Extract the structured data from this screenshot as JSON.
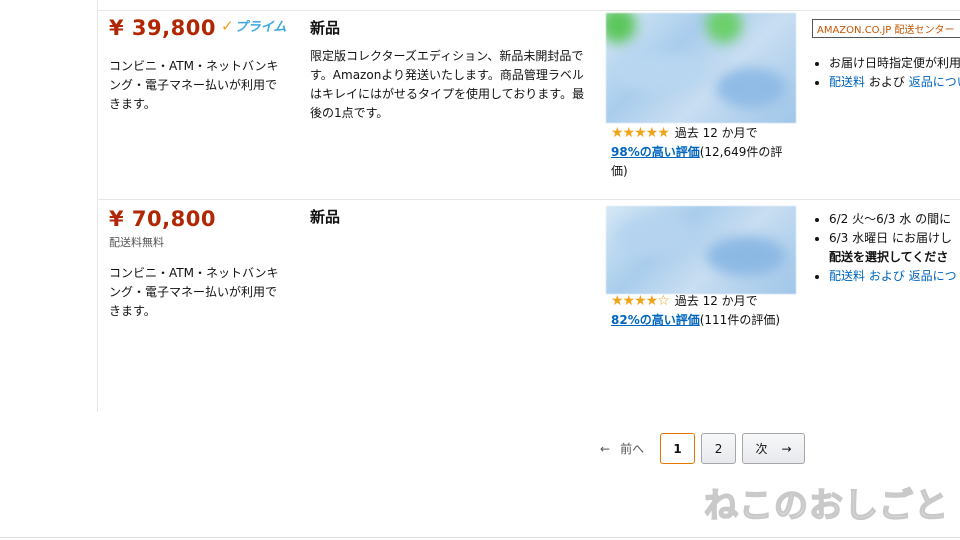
{
  "offers": [
    {
      "price": "¥ 39,800",
      "prime_label": "プライム",
      "shipping_note": "",
      "payment": "コンビニ・ATM・ネットバンキング・電子マネー払いが利用できます。",
      "condition": "新品",
      "description": "限定版コレクターズエディション、新品未開封品です。Amazonより発送いたします。商品管理ラベルはキレイにはがせるタイプを使用しております。最後の1点です。",
      "stars": "★★★★★",
      "period": "過去 12 か月で",
      "rating_link": "98%の高い評価",
      "rating_count": "(12,649件の評価)",
      "badge": "AMAZON.CO.JP 配送センター",
      "delivery": [
        {
          "text": "お届け日時指定便が利用",
          "links": []
        },
        {
          "text": "",
          "links": [
            "配送料",
            "および",
            "返品について"
          ]
        }
      ]
    },
    {
      "price": "¥ 70,800",
      "prime_label": "",
      "shipping_note": "配送料無料",
      "payment": "コンビニ・ATM・ネットバンキング・電子マネー払いが利用できます。",
      "condition": "新品",
      "description": "",
      "stars": "★★★★☆",
      "period": "過去 12 か月で",
      "rating_link": "82%の高い評価",
      "rating_count": "(111件の評価)",
      "delivery_lines": [
        "6/2 火～6/3 水 の間に",
        "6/3 水曜日 にお届けし",
        "配送を選択してくださ",
        "配送料 および 返品につ"
      ]
    }
  ],
  "pagination": {
    "prev": "前へ",
    "prev_arrow": "←",
    "pages": [
      "1",
      "2"
    ],
    "current": "1",
    "next": "次",
    "next_arrow": "→"
  },
  "watermark": "ねこのおしごと",
  "colors": {
    "price": "#B12704",
    "link": "#0066c0",
    "star": "#f0a41b",
    "current_page_border": "#e77600"
  }
}
